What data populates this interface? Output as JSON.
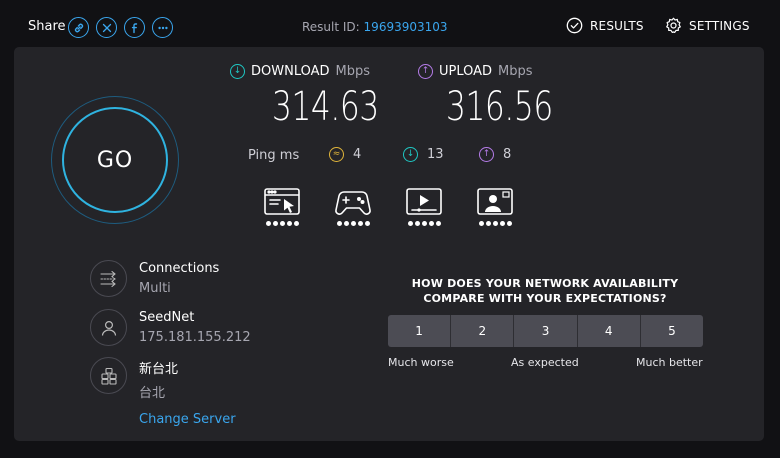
{
  "header": {
    "share_label": "Share",
    "share_icons": [
      "link-icon",
      "x-icon",
      "facebook-icon",
      "more-icon"
    ],
    "result_id_label": "Result ID:",
    "result_id_value": "19693903103",
    "results_label": "RESULTS",
    "settings_label": "SETTINGS"
  },
  "go_label": "GO",
  "download": {
    "label": "DOWNLOAD",
    "unit": "Mbps",
    "value": "314.63",
    "color": "#1fc7c3"
  },
  "upload": {
    "label": "UPLOAD",
    "unit": "Mbps",
    "value": "316.56",
    "color": "#b57ce8"
  },
  "ping": {
    "label": "Ping ms",
    "idle": "4",
    "download": "13",
    "upload": "8"
  },
  "activities": [
    {
      "name": "web-browsing-icon",
      "rating_dots": 5
    },
    {
      "name": "gaming-icon",
      "rating_dots": 5
    },
    {
      "name": "streaming-icon",
      "rating_dots": 5
    },
    {
      "name": "video-chat-icon",
      "rating_dots": 5
    }
  ],
  "connection": {
    "title": "Connections",
    "value": "Multi"
  },
  "isp": {
    "name": "SeedNet",
    "ip": "175.181.155.212"
  },
  "server": {
    "location": "新台北",
    "city": "台北",
    "change_label": "Change Server"
  },
  "survey": {
    "question_line1": "HOW DOES YOUR NETWORK AVAILABILITY",
    "question_line2": "COMPARE WITH YOUR EXPECTATIONS?",
    "options": [
      "1",
      "2",
      "3",
      "4",
      "5"
    ],
    "low_label": "Much worse",
    "mid_label": "As expected",
    "high_label": "Much better"
  },
  "colors": {
    "accent_blue": "#3aa6ee",
    "panel_bg": "#242428",
    "page_bg": "#111114",
    "idle_ping": "#e0b43a"
  }
}
